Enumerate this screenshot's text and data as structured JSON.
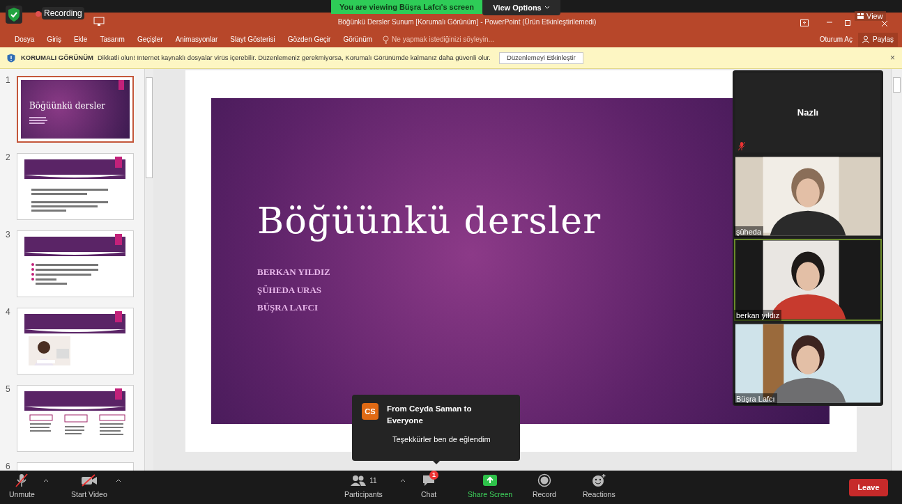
{
  "meeting": {
    "banner": "You are viewing Büşra Lafcı's screen",
    "view_options": "View Options",
    "recording": "Recording",
    "view": "View"
  },
  "powerpoint": {
    "title": "Böğünkü Dersler Sunum [Korumalı Görünüm] - PowerPoint (Ürün Etkinleştirilemedi)",
    "tabs": [
      {
        "label": "Dosya",
        "selected": false
      },
      {
        "label": "Giriş",
        "selected": false
      },
      {
        "label": "Ekle",
        "selected": false
      },
      {
        "label": "Tasarım",
        "selected": false
      },
      {
        "label": "Geçişler",
        "selected": false
      },
      {
        "label": "Animasyonlar",
        "selected": false
      },
      {
        "label": "Slayt Gösterisi",
        "selected": false
      },
      {
        "label": "Gözden Geçir",
        "selected": false
      },
      {
        "label": "Görünüm",
        "selected": false
      }
    ],
    "search_placeholder": "Ne yapmak istediğinizi söyleyin...",
    "sign_in": "Oturum Aç",
    "share": "Paylaş"
  },
  "protected_view": {
    "title": "KORUMALI GÖRÜNÜM",
    "message": "Dikkatli olun! Internet kaynaklı dosyalar virüs içerebilir. Düzenlemeniz gerekmiyorsa, Korumalı Görünümde kalmanız daha güvenli olur.",
    "button": "Düzenlemeyi Etkinleştir",
    "close": "×"
  },
  "thumbnails": [
    {
      "number": "1",
      "selected": true,
      "kind": "title",
      "title": "Böğüünkü dersler"
    },
    {
      "number": "2",
      "selected": false,
      "kind": "bullets"
    },
    {
      "number": "3",
      "selected": false,
      "kind": "list"
    },
    {
      "number": "4",
      "selected": false
    },
    {
      "number": "5",
      "selected": false,
      "kind": "columns"
    },
    {
      "number": "6",
      "selected": false,
      "kind": "blank"
    }
  ],
  "slide": {
    "title": "Böğüünkü dersler",
    "authors": [
      "BERKAN YILDIZ",
      "ŞÜHEDA URAS",
      "BÜŞRA LAFCI"
    ]
  },
  "participants": [
    {
      "name": "Nazlı",
      "kind": "avatar",
      "muted": true,
      "speaking": false
    },
    {
      "name": "şüheda",
      "kind": "video",
      "muted": false,
      "speaking": false
    },
    {
      "name": "berkan yıldız",
      "kind": "video",
      "muted": false,
      "speaking": true
    },
    {
      "name": "Büşra Lafcı",
      "kind": "video",
      "muted": false,
      "speaking": false
    }
  ],
  "chat_popup": {
    "initials": "CS",
    "sender": "From Ceyda Saman to Everyone",
    "message": "Teşekkürler ben de eğlendim"
  },
  "toolbar": [
    {
      "label": "Unmute",
      "kind": "mic_off"
    },
    {
      "label": "Start Video",
      "kind": "video_off"
    },
    {
      "label": "Participants",
      "kind": "participants",
      "count": "11"
    },
    {
      "label": "Chat",
      "kind": "chat",
      "badge": "1"
    },
    {
      "label": "Share Screen",
      "kind": "share"
    },
    {
      "label": "Record",
      "kind": "record"
    },
    {
      "label": "Reactions",
      "kind": "reactions"
    }
  ],
  "leave": "Leave"
}
